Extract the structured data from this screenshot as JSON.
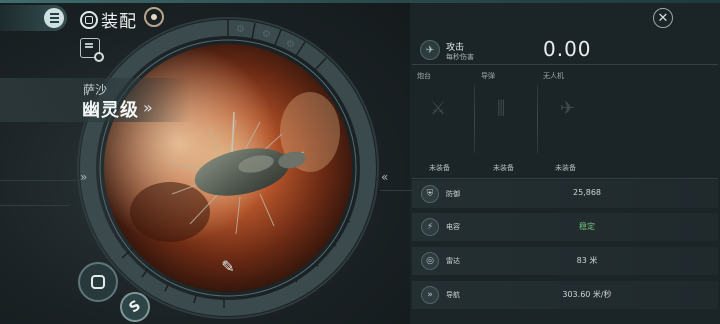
{
  "header": {
    "title": "装配",
    "close_symbol": "✕"
  },
  "ship": {
    "faction": "萨沙",
    "name": "幽灵级",
    "name_chevron": "»",
    "left_arrow": "»",
    "right_arrow": "«"
  },
  "offense": {
    "label": "攻击",
    "sublabel": "每秒伤害",
    "dps": "0.00",
    "slots": [
      {
        "title": "炮台",
        "status": "未装备"
      },
      {
        "title": "导弹",
        "status": "未装备"
      },
      {
        "title": "无人机",
        "status": "未装备"
      }
    ]
  },
  "stats": [
    {
      "label": "防御",
      "value": "25,868",
      "icon": "shield-icon"
    },
    {
      "label": "电容",
      "value": "稳定",
      "icon": "capacitor-icon"
    },
    {
      "label": "雷达",
      "value": "83 米",
      "icon": "radar-icon"
    },
    {
      "label": "导航",
      "value": "303.60 米/秒",
      "icon": "navigation-icon"
    }
  ],
  "colors": {
    "accent": "#3f6d6d",
    "positive": "#72c27b",
    "nebula": "#b5542a"
  }
}
